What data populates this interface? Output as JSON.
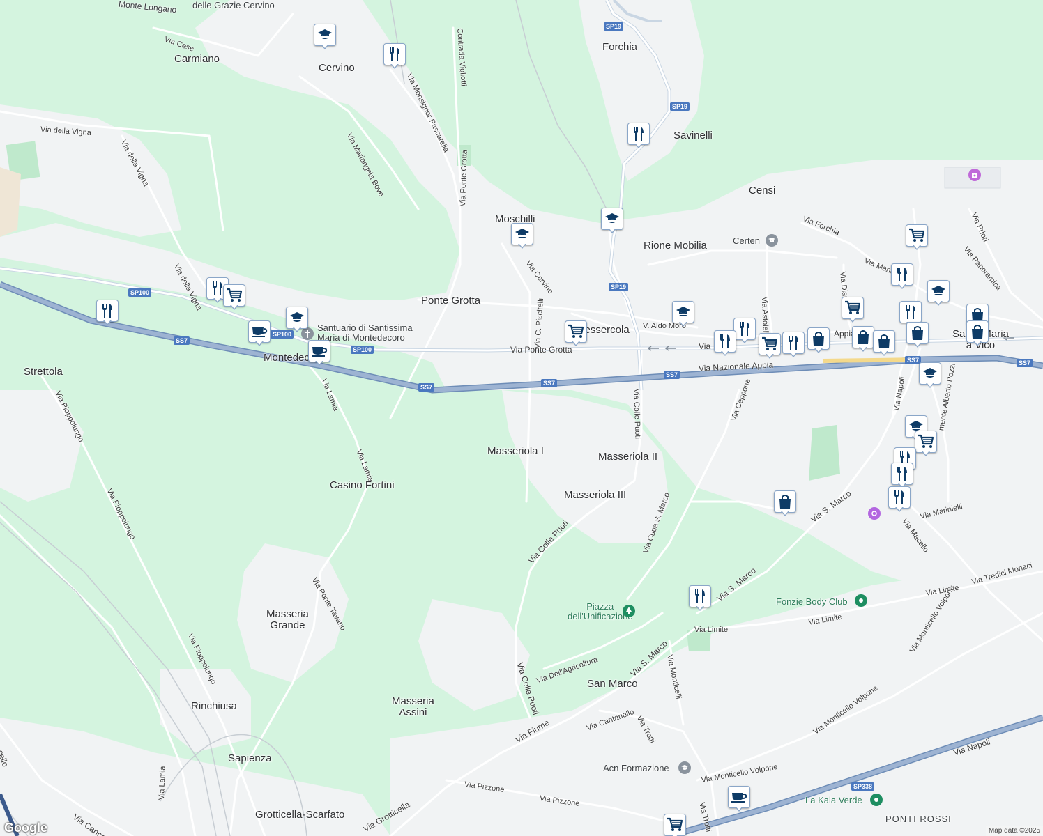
{
  "map": {
    "attribution": "Map data ©2025",
    "logo": "Google",
    "colors": {
      "vegetation": "#d4f4df",
      "urban": "#f1f3f4",
      "road": "#ffffff",
      "highway": "#8aa3c4",
      "marker_icon": "#0e3b66"
    }
  },
  "places": [
    {
      "id": "carmiano",
      "label": "Carmiano"
    },
    {
      "id": "cervino",
      "label": "Cervino"
    },
    {
      "id": "forchia",
      "label": "Forchia"
    },
    {
      "id": "savinelli",
      "label": "Savinelli"
    },
    {
      "id": "censi",
      "label": "Censi"
    },
    {
      "id": "moschilli",
      "label": "Moschilli"
    },
    {
      "id": "rione-mobilia",
      "label": "Rione Mobilia"
    },
    {
      "id": "ponte-grotta",
      "label": "Ponte Grotta"
    },
    {
      "id": "montedecoro",
      "label": "Montedecoro"
    },
    {
      "id": "strettola",
      "label": "Strettola"
    },
    {
      "id": "masseriola-1",
      "label": "Masseriola I"
    },
    {
      "id": "masseriola-2",
      "label": "Masseriola II"
    },
    {
      "id": "masseriola-3",
      "label": "Masseriola III"
    },
    {
      "id": "casino-fortini",
      "label": "Casino Fortini"
    },
    {
      "id": "masseria-grande",
      "label": "Masseria\nGrande"
    },
    {
      "id": "masseria-assini",
      "label": "Masseria\nAssini"
    },
    {
      "id": "rinchiusa",
      "label": "Rinchiusa"
    },
    {
      "id": "sapienza",
      "label": "Sapienza"
    },
    {
      "id": "grotticella-scarfato",
      "label": "Grotticella-Scarfato"
    },
    {
      "id": "san-marco",
      "label": "San Marco"
    },
    {
      "id": "santa-maria-a-vico",
      "label": "Santa Maria\na Vico"
    },
    {
      "id": "ponti-rossi",
      "label": "PONTI ROSSI"
    },
    {
      "id": "messercola",
      "label": "Messercola"
    },
    {
      "id": "monte-longano",
      "label": "Monte Longano"
    },
    {
      "id": "delle-grazie",
      "label": "delle Grazie Cervino"
    }
  ],
  "pois": [
    {
      "id": "certen",
      "label": "Certen",
      "icon": "school-icon"
    },
    {
      "id": "santuario",
      "label": "Santuario di Santissima\nMaria di Montedecoro",
      "icon": "worship-icon"
    },
    {
      "id": "fonzie",
      "label": "Fonzie Body Club",
      "icon": "gym-icon"
    },
    {
      "id": "piazza",
      "label": "Piazza\ndell'Unificazione",
      "icon": "park-icon"
    },
    {
      "id": "acn",
      "label": "Acn Formazione",
      "icon": "school-icon"
    },
    {
      "id": "kala-verde",
      "label": "La Kala Verde",
      "icon": "recreation-icon"
    }
  ],
  "streets": [
    {
      "id": "via-della-vigna",
      "label": "Via della Vigna"
    },
    {
      "id": "via-della-vigna-2",
      "label": "Via della Vigna"
    },
    {
      "id": "via-della-vigna-3",
      "label": "Via della Vigna"
    },
    {
      "id": "via-cese",
      "label": "Via Cese"
    },
    {
      "id": "via-mariangela-bove",
      "label": "Via Mariangela Bove"
    },
    {
      "id": "via-monsignor-pascarella",
      "label": "Via Monsignor Pascarella"
    },
    {
      "id": "contrada-vigliotti",
      "label": "Contrada Vigliotti"
    },
    {
      "id": "via-ponte-grotta-v",
      "label": "Via Ponte Grotta"
    },
    {
      "id": "via-cervino",
      "label": "Via Cervino"
    },
    {
      "id": "via-c-piscitelli",
      "label": "Via C. Piscitelli"
    },
    {
      "id": "via-ponte-grotta-h",
      "label": "Via Ponte Grotta"
    },
    {
      "id": "via-nazionale-appia",
      "label": "Via Nazionale Appia"
    },
    {
      "id": "via-colle-puoti-1",
      "label": "Via Colle Puoti"
    },
    {
      "id": "via-colle-puoti-2",
      "label": "Via Colle Puoti"
    },
    {
      "id": "via-colle-puoti-3",
      "label": "Via Colle Puoti"
    },
    {
      "id": "via-lamia-1",
      "label": "Via Lamia"
    },
    {
      "id": "via-lamia-2",
      "label": "Via Lamia"
    },
    {
      "id": "via-lamia-3",
      "label": "Via Lamia"
    },
    {
      "id": "via-pioppolungo-1",
      "label": "Via Pioppolungo"
    },
    {
      "id": "via-pioppolungo-2",
      "label": "Via Pioppolungo"
    },
    {
      "id": "via-pioppolungo-3",
      "label": "Via Pioppolungo"
    },
    {
      "id": "via-ponte-tavano",
      "label": "Via Ponte Tavano"
    },
    {
      "id": "via-cupa-s-marco",
      "label": "Via Cupa S. Marco"
    },
    {
      "id": "via-ceppone",
      "label": "Via Ceppone"
    },
    {
      "id": "via-astolelli",
      "label": "Via Astolelli"
    },
    {
      "id": "via-diana",
      "label": "Via Diana"
    },
    {
      "id": "via-forchia",
      "label": "Via Forchia"
    },
    {
      "id": "via-priori",
      "label": "Via Priori"
    },
    {
      "id": "via-panoramica",
      "label": "Via Panoramica"
    },
    {
      "id": "via-napoli-1",
      "label": "Via Napoli"
    },
    {
      "id": "via-napoli-2",
      "label": "Via Napoli"
    },
    {
      "id": "via-s-marco-1",
      "label": "Via S. Marco"
    },
    {
      "id": "via-s-marco-2",
      "label": "Via S. Marco"
    },
    {
      "id": "via-s-marco-3",
      "label": "Via S. Marco"
    },
    {
      "id": "via-marinielli",
      "label": "Via Marinielli"
    },
    {
      "id": "via-macello",
      "label": "Via Macello"
    },
    {
      "id": "via-limite-1",
      "label": "Via Limite"
    },
    {
      "id": "via-limite-2",
      "label": "Via Limite"
    },
    {
      "id": "via-limite-3",
      "label": "Via Limite"
    },
    {
      "id": "via-tredici-monaci",
      "label": "Via Tredici Monaci"
    },
    {
      "id": "via-monticello-volpone-1",
      "label": "Via Monticello Volpone"
    },
    {
      "id": "via-monticello-volpone-2",
      "label": "Via Monticello Volpone"
    },
    {
      "id": "via-monticello-volpone-3",
      "label": "Via Monticello Volpone"
    },
    {
      "id": "via-monticelli",
      "label": "Via Monticelli"
    },
    {
      "id": "via-dell-agricoltura",
      "label": "Via Dell'Agricoltura"
    },
    {
      "id": "via-cantariello",
      "label": "Via Cantariello"
    },
    {
      "id": "via-trotti-1",
      "label": "Via Trotti"
    },
    {
      "id": "via-trotti-2",
      "label": "Via Trotti"
    },
    {
      "id": "via-fiume",
      "label": "Via Fiume"
    },
    {
      "id": "via-pizzone-1",
      "label": "Via Pizzone"
    },
    {
      "id": "via-pizzone-2",
      "label": "Via Pizzone"
    },
    {
      "id": "via-grotticella",
      "label": "Via Grotticella"
    },
    {
      "id": "via-cancello",
      "label": "Via Cancello"
    },
    {
      "id": "via-aldo-moro",
      "label": "V. Aldo Moro"
    },
    {
      "id": "via-manc",
      "label": "Via Manc"
    },
    {
      "id": "via-appia-short",
      "label": "Appia"
    },
    {
      "id": "via-generale",
      "label": "Via"
    },
    {
      "id": "via-cello",
      "label": "cello"
    },
    {
      "id": "via-mente-alberto",
      "label": "mente Alberto Pozzi"
    },
    {
      "id": "via-lamia-bottom",
      "label": "Via Lamia"
    }
  ],
  "shields": [
    {
      "id": "sp19-top",
      "label": "SP19"
    },
    {
      "id": "sp19-mid",
      "label": "SP19"
    },
    {
      "id": "sp19-low",
      "label": "SP19"
    },
    {
      "id": "sp100-a",
      "label": "SP100"
    },
    {
      "id": "sp100-b",
      "label": "SP100"
    },
    {
      "id": "sp100-c",
      "label": "SP100"
    },
    {
      "id": "ss7-a",
      "label": "SS7"
    },
    {
      "id": "ss7-b",
      "label": "SS7"
    },
    {
      "id": "ss7-c",
      "label": "SS7"
    },
    {
      "id": "ss7-d",
      "label": "SS7"
    },
    {
      "id": "ss7-e",
      "label": "SS7"
    },
    {
      "id": "ss7-f",
      "label": "SS7"
    },
    {
      "id": "sp338",
      "label": "SP338"
    }
  ],
  "markers": [
    {
      "id": "m1",
      "type": "school"
    },
    {
      "id": "m2",
      "type": "restaurant"
    },
    {
      "id": "m3",
      "type": "restaurant"
    },
    {
      "id": "m4",
      "type": "school"
    },
    {
      "id": "m5",
      "type": "school"
    },
    {
      "id": "m6",
      "type": "restaurant"
    },
    {
      "id": "m7",
      "type": "cart"
    },
    {
      "id": "m8",
      "type": "restaurant"
    },
    {
      "id": "m9",
      "type": "cafe"
    },
    {
      "id": "m10",
      "type": "school"
    },
    {
      "id": "m11",
      "type": "cafe"
    },
    {
      "id": "m12",
      "type": "cart"
    },
    {
      "id": "m13",
      "type": "school"
    },
    {
      "id": "m14",
      "type": "restaurant"
    },
    {
      "id": "m15",
      "type": "restaurant"
    },
    {
      "id": "m16",
      "type": "cart"
    },
    {
      "id": "m17",
      "type": "restaurant"
    },
    {
      "id": "m18",
      "type": "bag"
    },
    {
      "id": "m19",
      "type": "cart"
    },
    {
      "id": "m20",
      "type": "bag"
    },
    {
      "id": "m21",
      "type": "bag"
    },
    {
      "id": "m22",
      "type": "cart"
    },
    {
      "id": "m23",
      "type": "restaurant"
    },
    {
      "id": "m24",
      "type": "school"
    },
    {
      "id": "m25",
      "type": "restaurant"
    },
    {
      "id": "m26",
      "type": "bag"
    },
    {
      "id": "m27",
      "type": "bag"
    },
    {
      "id": "m28",
      "type": "bag"
    },
    {
      "id": "m29",
      "type": "school"
    },
    {
      "id": "m30",
      "type": "school"
    },
    {
      "id": "m31",
      "type": "cart"
    },
    {
      "id": "m32",
      "type": "restaurant"
    },
    {
      "id": "m33",
      "type": "restaurant"
    },
    {
      "id": "m34",
      "type": "restaurant"
    },
    {
      "id": "m35",
      "type": "bag"
    },
    {
      "id": "m36",
      "type": "restaurant"
    },
    {
      "id": "m37",
      "type": "cafe"
    },
    {
      "id": "m38",
      "type": "cart"
    }
  ]
}
